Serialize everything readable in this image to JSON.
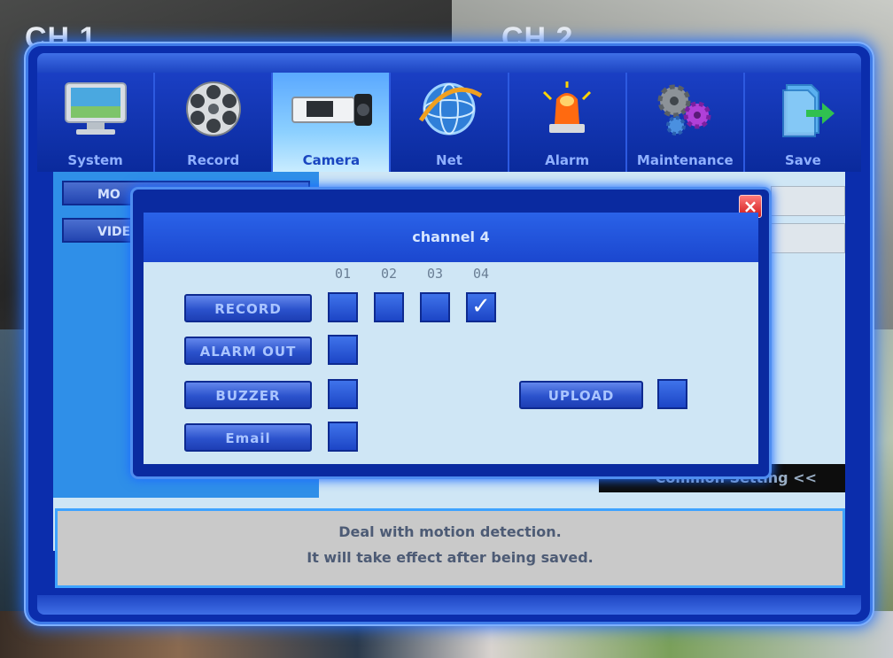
{
  "background": {
    "channels": [
      "CH 1",
      "CH 2"
    ]
  },
  "tabs": [
    {
      "label": "System",
      "icon": "monitor-icon",
      "active": false
    },
    {
      "label": "Record",
      "icon": "film-reel-icon",
      "active": false
    },
    {
      "label": "Camera",
      "icon": "camera-icon",
      "active": true
    },
    {
      "label": "Net",
      "icon": "globe-icon",
      "active": false
    },
    {
      "label": "Alarm",
      "icon": "alarm-light-icon",
      "active": false
    },
    {
      "label": "Maintenance",
      "icon": "gears-icon",
      "active": false
    },
    {
      "label": "Save",
      "icon": "save-arrow-icon",
      "active": false
    }
  ],
  "panel": {
    "side_buttons": [
      "MO",
      "VIDE"
    ],
    "common_setting": "Common Setting <<"
  },
  "dialog": {
    "title": "channel 4",
    "close_icon": "close-icon",
    "columns": [
      "01",
      "02",
      "03",
      "04"
    ],
    "rows": [
      {
        "label": "RECORD",
        "checks": [
          false,
          false,
          false,
          true
        ]
      },
      {
        "label": "ALARM OUT",
        "checks": [
          false
        ]
      },
      {
        "label": "BUZZER",
        "checks": [
          false
        ]
      },
      {
        "label": "Email",
        "checks": [
          false
        ]
      }
    ],
    "upload_label": "UPLOAD",
    "upload_checked": false
  },
  "info": {
    "line1": "Deal with motion detection.",
    "line2": "It will take effect after being saved."
  },
  "colors": {
    "frame_blue": "#0b2dac",
    "accent_glow": "#3f7be8",
    "panel_light": "#cfe6f5",
    "close_red": "#d01818"
  }
}
